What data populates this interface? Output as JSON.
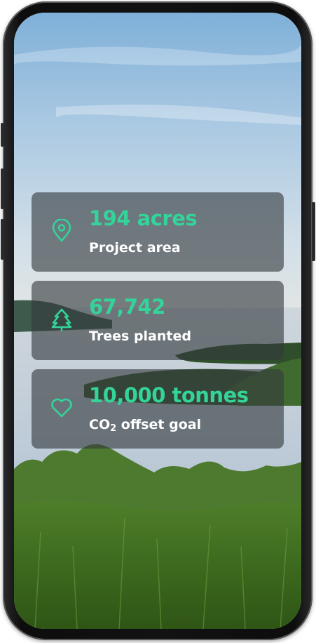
{
  "colors": {
    "accent": "#34d39a",
    "card_background": "#343a3e",
    "label_text": "#ffffff",
    "phone_frame": "#121213"
  },
  "stats": [
    {
      "icon": "map-pin-icon",
      "value": "194 acres",
      "label": "Project area"
    },
    {
      "icon": "tree-icon",
      "value": "67,742",
      "label": "Trees planted"
    },
    {
      "icon": "heart-icon",
      "value": "10,000 tonnes",
      "label_prefix": "CO",
      "label_subscript": "2",
      "label_suffix": " offset goal"
    }
  ]
}
